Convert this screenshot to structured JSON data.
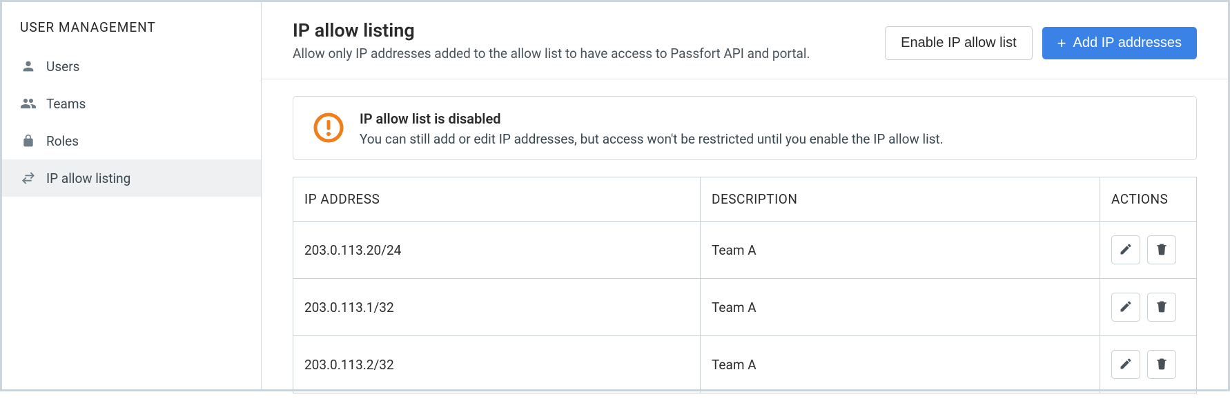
{
  "sidebar": {
    "title": "USER MANAGEMENT",
    "items": [
      {
        "label": "Users",
        "icon": "person"
      },
      {
        "label": "Teams",
        "icon": "people"
      },
      {
        "label": "Roles",
        "icon": "lock"
      },
      {
        "label": "IP allow listing",
        "icon": "swap"
      }
    ],
    "activeIndex": 3
  },
  "header": {
    "title": "IP allow listing",
    "subtitle": "Allow only IP addresses added to the allow list to have access to Passfort API and portal.",
    "enable_button": "Enable IP allow list",
    "add_button": "Add IP addresses"
  },
  "alert": {
    "title": "IP allow list is disabled",
    "text": "You can still add or edit IP addresses, but access won't be restricted until you enable the IP allow list."
  },
  "table": {
    "headers": {
      "ip": "IP ADDRESS",
      "desc": "DESCRIPTION",
      "actions": "ACTIONS"
    },
    "rows": [
      {
        "ip": "203.0.113.20/24",
        "desc": "Team A"
      },
      {
        "ip": "203.0.113.1/32",
        "desc": "Team A"
      },
      {
        "ip": "203.0.113.2/32",
        "desc": "Team A"
      }
    ]
  }
}
